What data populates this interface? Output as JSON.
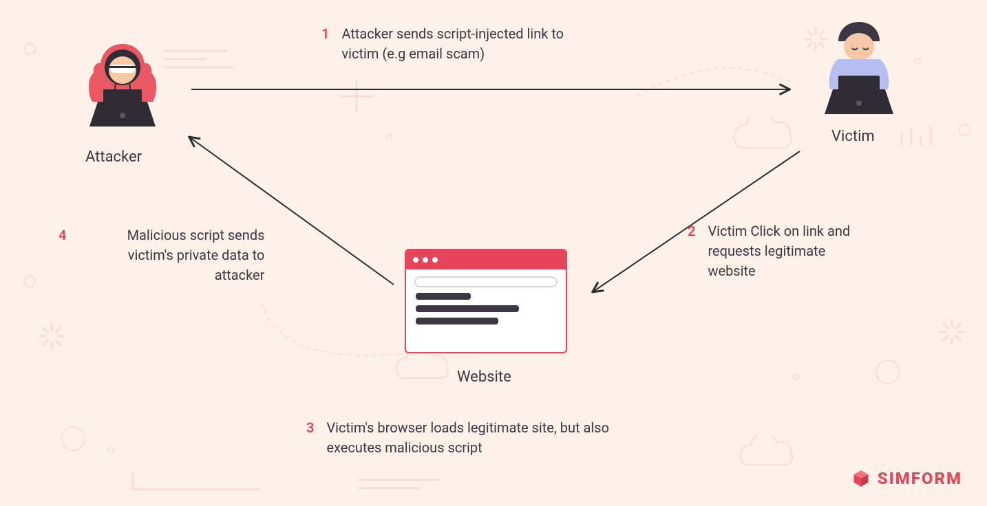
{
  "nodes": {
    "attacker": "Attacker",
    "victim": "Victim",
    "website": "Website"
  },
  "steps": {
    "s1": {
      "num": "1",
      "text": "Attacker sends script-injected link to victim (e.g email scam)"
    },
    "s2": {
      "num": "2",
      "text": "Victim Click on link and requests legitimate website"
    },
    "s3": {
      "num": "3",
      "text": "Victim's browser loads legitimate site, but also executes malicious script"
    },
    "s4": {
      "num": "4",
      "text": "Malicious script sends victim's private data to attacker"
    }
  },
  "brand": {
    "name": "SIMFORM"
  },
  "colors": {
    "accent": "#e5445a",
    "bg": "#fdf1e9",
    "text": "#3b3740",
    "deco": "#f3c9c7"
  }
}
